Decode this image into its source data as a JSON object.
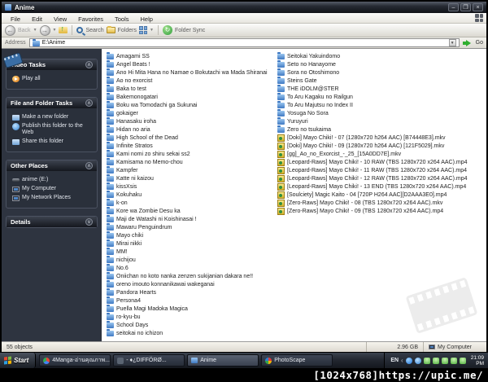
{
  "window": {
    "title": "Anime",
    "controls": {
      "minimize": "–",
      "restore": "❐",
      "close": "×"
    }
  },
  "menu_bar": {
    "items": [
      "File",
      "Edit",
      "View",
      "Favorites",
      "Tools",
      "Help"
    ]
  },
  "toolbar": {
    "back_label": "Back",
    "search_label": "Search",
    "folders_label": "Folders",
    "folder_sync_label": "Folder Sync"
  },
  "address_bar": {
    "label": "Address",
    "value": "E:\\Anime",
    "go_label": "Go"
  },
  "sidebar": {
    "panels": [
      {
        "title": "Video Tasks",
        "items": [
          {
            "icon": "play",
            "label": "Play all"
          }
        ]
      },
      {
        "title": "File and Folder Tasks",
        "items": [
          {
            "icon": "new-folder",
            "label": "Make a new folder"
          },
          {
            "icon": "publish-web",
            "label": "Publish this folder to the Web"
          },
          {
            "icon": "share-folder",
            "label": "Share this folder"
          }
        ]
      },
      {
        "title": "Other Places",
        "items": [
          {
            "icon": "drive",
            "label": "anime (E:)"
          },
          {
            "icon": "my-computer",
            "label": "My Computer"
          },
          {
            "icon": "network",
            "label": "My Network Places"
          }
        ]
      },
      {
        "title": "Details",
        "items": []
      }
    ]
  },
  "files": {
    "column1": [
      {
        "type": "folder",
        "name": "Amagami SS"
      },
      {
        "type": "folder",
        "name": "Angel Beats !"
      },
      {
        "type": "folder",
        "name": "Ano Hi Mita Hana no Namae o Bokutachi wa Mada Shiranai"
      },
      {
        "type": "folder",
        "name": "Ao no exorcist"
      },
      {
        "type": "folder",
        "name": "Baka to test"
      },
      {
        "type": "folder",
        "name": "Bakemonogatari"
      },
      {
        "type": "folder",
        "name": "Boku wa Tomodachi ga Sukunai"
      },
      {
        "type": "folder",
        "name": "gokaiger"
      },
      {
        "type": "folder",
        "name": "Hanasaku iroha"
      },
      {
        "type": "folder",
        "name": "Hidan no aria"
      },
      {
        "type": "folder",
        "name": "High School of the Dead"
      },
      {
        "type": "folder",
        "name": "Infinite Stratos"
      },
      {
        "type": "folder",
        "name": "Kami nomi zo shiru sekai ss2"
      },
      {
        "type": "folder",
        "name": "Kamisama no Memo-chou"
      },
      {
        "type": "folder",
        "name": "Kampfer"
      },
      {
        "type": "folder",
        "name": "Katte ni kaizou"
      },
      {
        "type": "folder",
        "name": "kissXsis"
      },
      {
        "type": "folder",
        "name": "Kokuhaku"
      },
      {
        "type": "folder",
        "name": "k-on"
      },
      {
        "type": "folder",
        "name": "Kore wa Zombie Desu ka"
      },
      {
        "type": "folder",
        "name": "Maji de Watashi ni Koishinasai !"
      },
      {
        "type": "folder",
        "name": "Mawaru Penguindrum"
      },
      {
        "type": "folder",
        "name": "Mayo chiki"
      },
      {
        "type": "folder",
        "name": "Mirai nikki"
      },
      {
        "type": "folder",
        "name": "MM!"
      },
      {
        "type": "folder",
        "name": "nichijou"
      },
      {
        "type": "folder",
        "name": "No.6"
      },
      {
        "type": "folder",
        "name": "Oniichan no koto nanka zenzen sukijanian dakara ne!!"
      },
      {
        "type": "folder",
        "name": "oreno imouto konnanikawai wakeganai"
      },
      {
        "type": "folder",
        "name": "Pandora Hearts"
      },
      {
        "type": "folder",
        "name": "Persona4"
      },
      {
        "type": "folder",
        "name": "Puella Magi Madoka Magica"
      },
      {
        "type": "folder",
        "name": "ro-kyu-bu"
      },
      {
        "type": "folder",
        "name": "School Days"
      },
      {
        "type": "folder",
        "name": "seitokai no ichizon"
      }
    ],
    "column2": [
      {
        "type": "folder",
        "name": "Seitokai Yakuindomo"
      },
      {
        "type": "folder",
        "name": "Seto no Hanayome"
      },
      {
        "type": "folder",
        "name": "Sora no Otoshimono"
      },
      {
        "type": "folder",
        "name": "Steins Gate"
      },
      {
        "type": "folder",
        "name": "THE iDOLM@STER"
      },
      {
        "type": "folder",
        "name": "To Aru Kagaku no Railgun"
      },
      {
        "type": "folder",
        "name": "To Aru Majutsu no Index II"
      },
      {
        "type": "folder",
        "name": "Yosuga No Sora"
      },
      {
        "type": "folder",
        "name": "Yuruyuri"
      },
      {
        "type": "folder",
        "name": "Zero no tsukaima"
      },
      {
        "type": "video",
        "name": "[Doki] Mayo Chiki! - 07 (1280x720 h264 AAC) [B74448E3].mkv"
      },
      {
        "type": "video",
        "name": "[Doki] Mayo Chiki! - 09 (1280x720 h264 AAC) [121F5029].mkv"
      },
      {
        "type": "video",
        "name": "[gg]_Ao_no_Exorcist_-_25_[15A0DD7E].mkv"
      },
      {
        "type": "video",
        "name": "[Leopard-Raws] Mayo Chiki! - 10 RAW (TBS 1280x720 x264 AAC).mp4"
      },
      {
        "type": "video",
        "name": "[Leopard-Raws] Mayo Chiki! - 11 RAW (TBS 1280x720 x264 AAC).mp4"
      },
      {
        "type": "video",
        "name": "[Leopard-Raws] Mayo Chiki! - 12 RAW (TBS 1280x720 x264 AAC).mp4"
      },
      {
        "type": "video",
        "name": "[Leopard-Raws] Mayo Chiki! - 13 END (TBS 1280x720 x264 AAC).mp4"
      },
      {
        "type": "video",
        "name": "[Soulciety] Magic Kaito - 04 [720P H264 AAC][D2AAA3E0].mp4"
      },
      {
        "type": "video",
        "name": "[Zero-Raws] Mayo Chiki! - 08 (TBS 1280x720 x264 AAC).mkv"
      },
      {
        "type": "video",
        "name": "[Zero-Raws] Mayo Chiki! - 09 (TBS 1280x720 x264 AAC).mp4"
      }
    ]
  },
  "status_bar": {
    "objects": "55 objects",
    "free_space": "2.96 GB",
    "zone": "My Computer"
  },
  "taskbar": {
    "start_label": "Start",
    "tasks": [
      {
        "icon": "chrome",
        "state": "normal",
        "label": "4Manga-อ่านคุณภาพ..."
      },
      {
        "icon": "app",
        "state": "normal",
        "label": "- ♦¿DIFFÖRØ..."
      },
      {
        "icon": "folder",
        "state": "active",
        "label": "Anime"
      },
      {
        "icon": "photoscape",
        "state": "normal",
        "label": "PhotoScape"
      }
    ],
    "tray": {
      "language": "EN",
      "clock_time": "21:09",
      "clock_period": "PM"
    }
  },
  "watermark": "[1024x768]https://upic.me/"
}
